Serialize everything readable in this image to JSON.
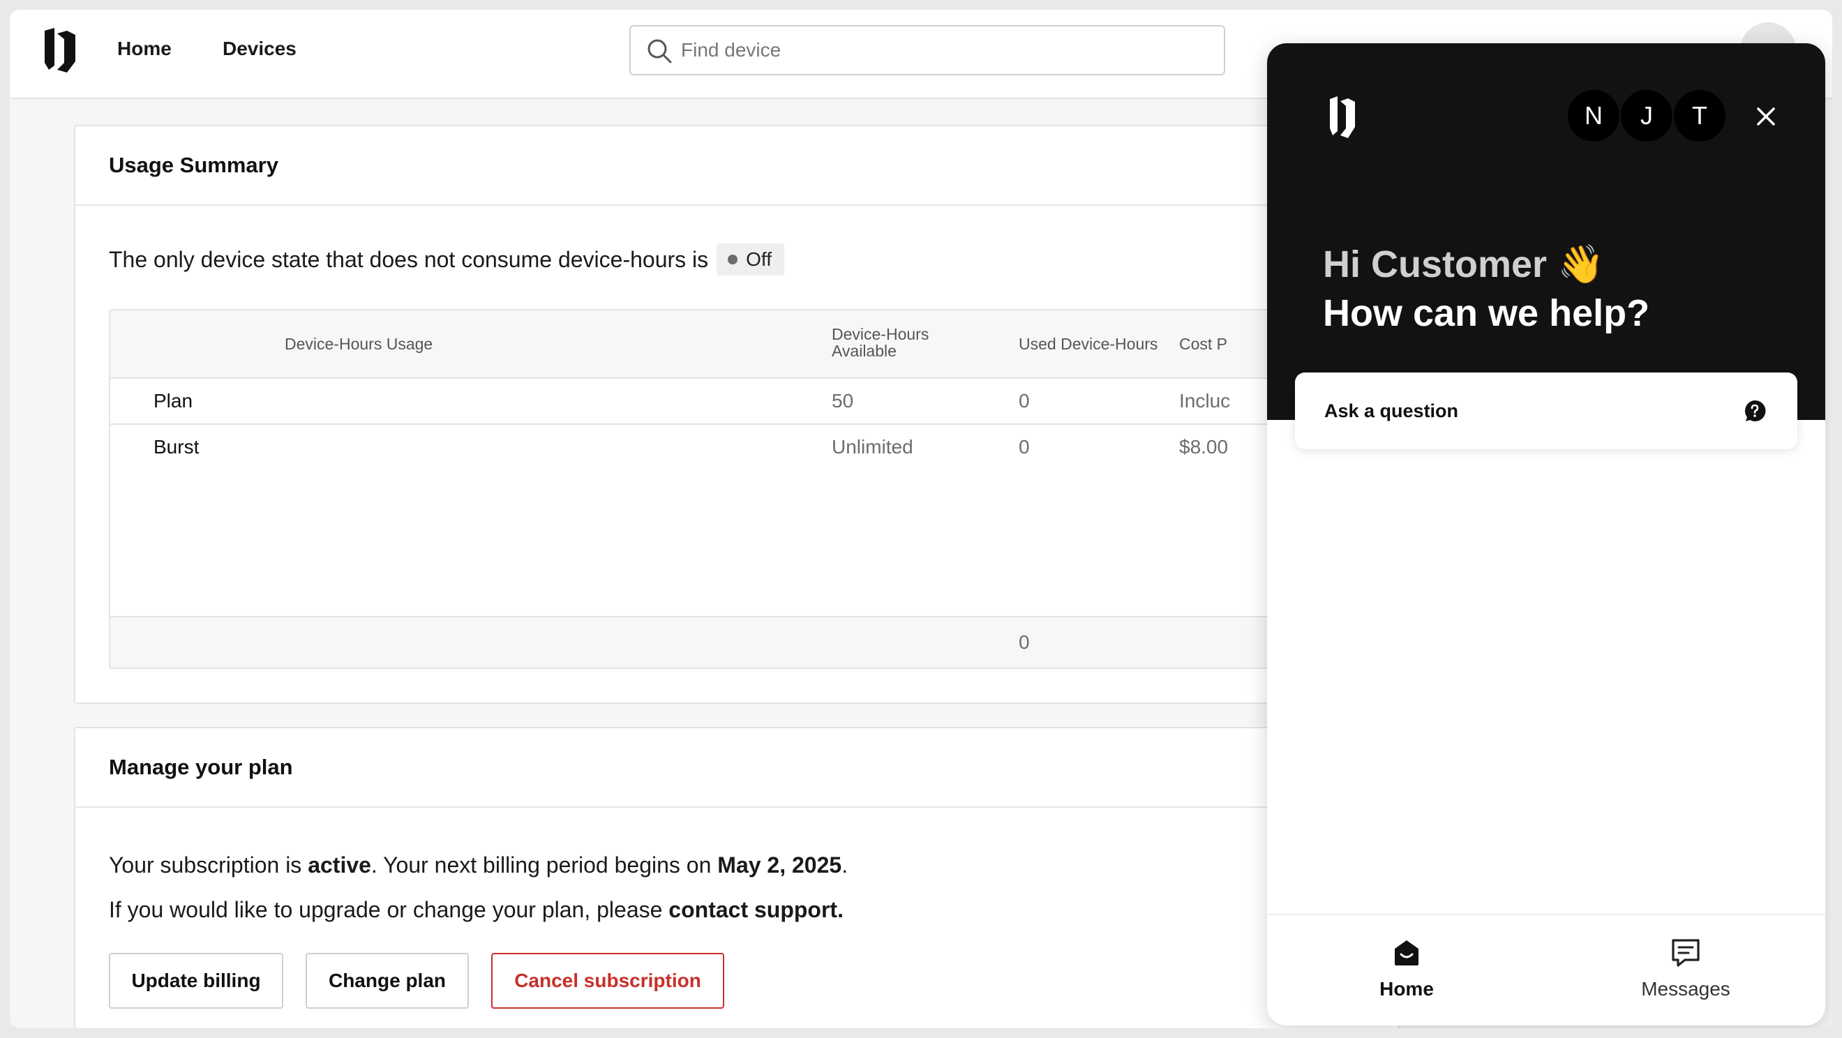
{
  "nav": {
    "home": "Home",
    "devices": "Devices",
    "search_placeholder": "Find device"
  },
  "usage": {
    "title": "Usage Summary",
    "state_text": "The only device state that does not consume device-hours is",
    "state_badge": "Off",
    "columns": [
      "Device-Hours Usage",
      "Device-Hours Available",
      "Used Device-Hours",
      "Cost P"
    ],
    "rows": [
      {
        "name": "Plan",
        "available": "50",
        "used": "0",
        "cost": "Incluc"
      },
      {
        "name": "Burst",
        "available": "Unlimited",
        "used": "0",
        "cost": "$8.00"
      }
    ],
    "total_used": "0"
  },
  "plan": {
    "title": "Manage your plan",
    "line1_prefix": "Your subscription is ",
    "line1_status": "active",
    "line1_mid": ". Your next billing period begins on ",
    "line1_date": "May 2, 2025",
    "line1_suffix": ".",
    "line2_prefix": "If you would like to upgrade or change your plan, please ",
    "line2_link": "contact support.",
    "buttons": {
      "update_billing": "Update billing",
      "change_plan": "Change plan",
      "cancel": "Cancel subscription"
    }
  },
  "chat": {
    "agents": [
      "N",
      "J",
      "T"
    ],
    "greeting_line1": "Hi Customer 👋",
    "greeting_line2": "How can we help?",
    "ask_label": "Ask a question",
    "tabs": {
      "home": "Home",
      "messages": "Messages"
    }
  },
  "colors": {
    "danger": "#c7302a",
    "chat_header": "#121212"
  }
}
